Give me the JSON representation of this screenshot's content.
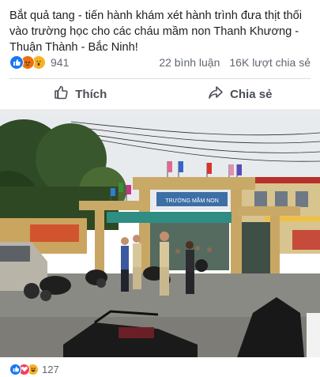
{
  "post": {
    "caption": "Bắt quả tang - tiến hành khám xét hành trình đưa thịt thối vào trường học cho các cháu mầm non Thanh Khương - Thuận Thành - Bắc Ninh!",
    "reactions": [
      "like-icon",
      "angry-icon",
      "wow-icon"
    ],
    "reaction_count": "941",
    "comments": "22 bình luận",
    "shares": "16K lượt chia sẻ"
  },
  "actions": {
    "like_label": "Thích",
    "share_label": "Chia sẻ"
  },
  "photo": {
    "gate_sign": "TRƯỜNG MẦM NON",
    "banner_left": "",
    "banner_right": ""
  },
  "next_post": {
    "reactions": [
      "like-icon",
      "love-icon",
      "haha-icon"
    ],
    "reaction_count": "127"
  },
  "colors": {
    "accent": "#1877f2",
    "text": "#1c1e21",
    "muted": "#606770"
  }
}
